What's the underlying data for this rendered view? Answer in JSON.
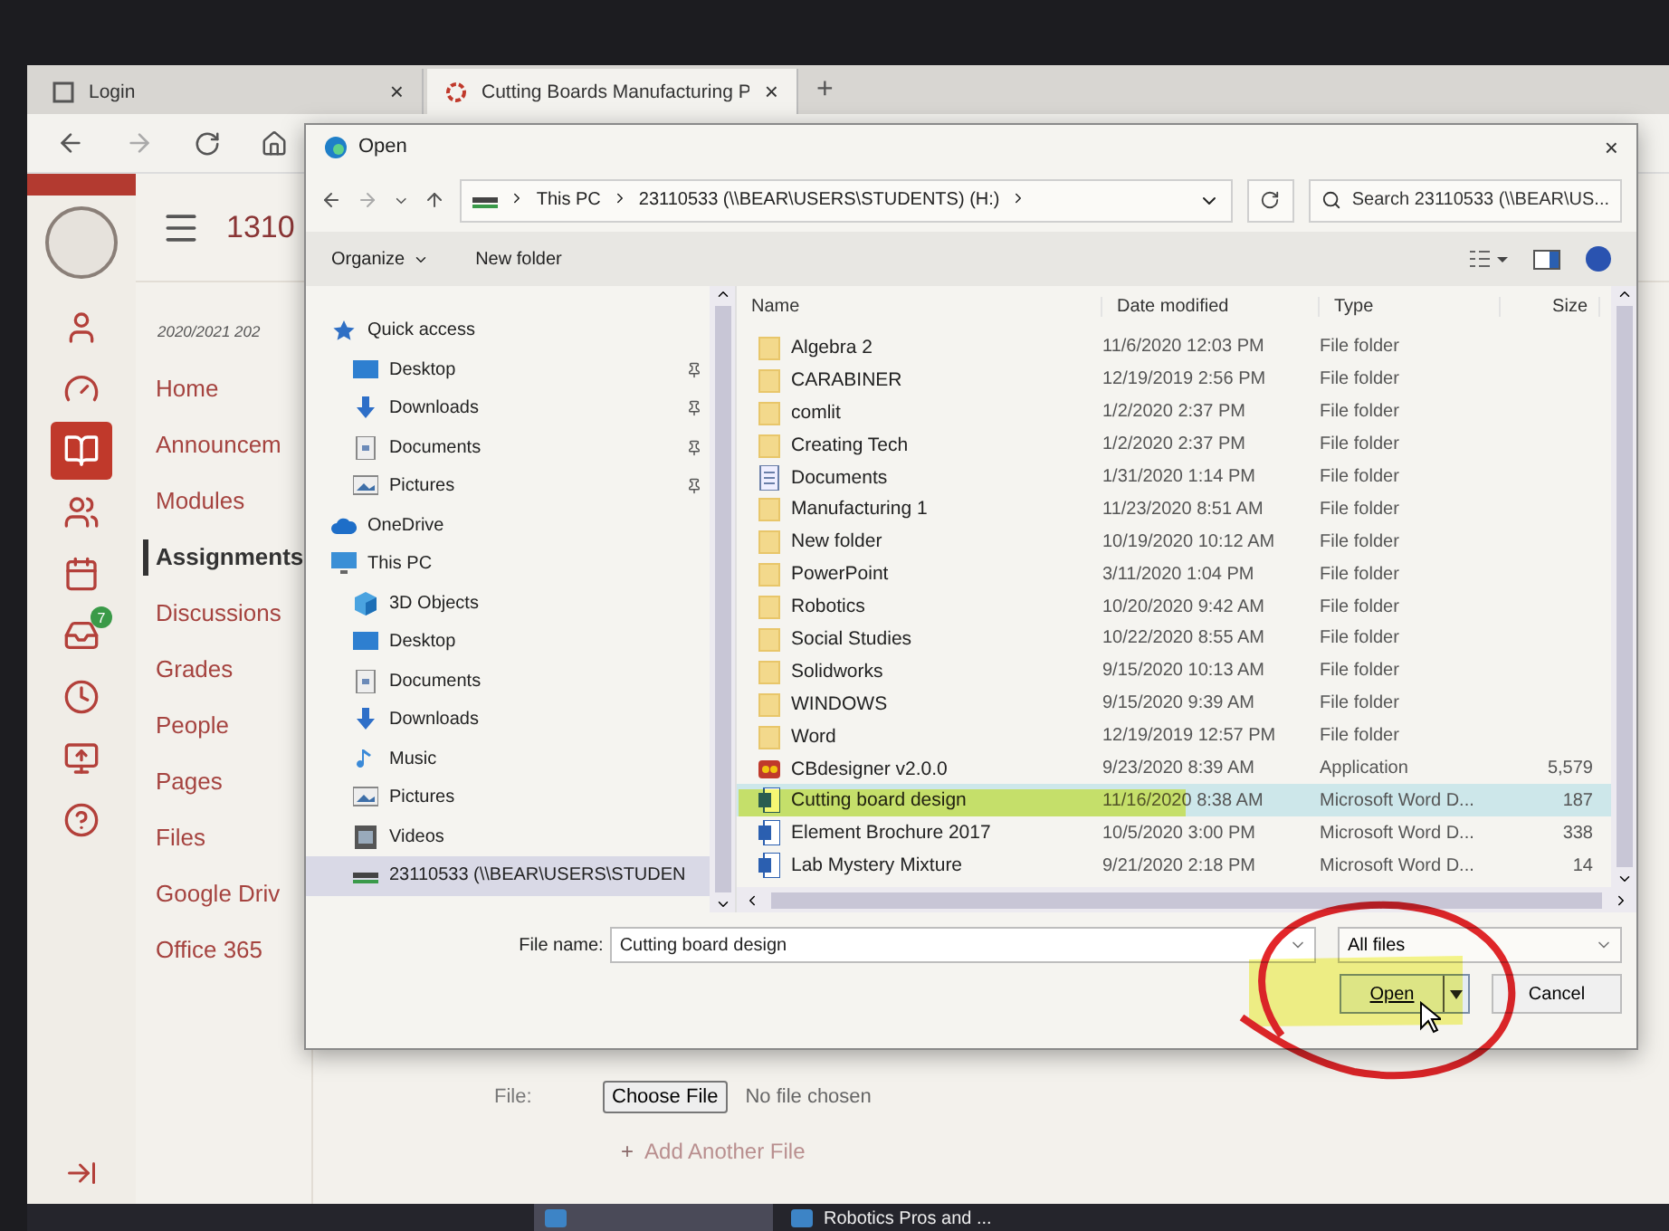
{
  "browser": {
    "tabs": [
      {
        "label": "Login",
        "close": "×",
        "selected": false
      },
      {
        "label": "Cutting Boards Manufacturing P",
        "close": "×",
        "selected": true
      }
    ],
    "new_tab": "+"
  },
  "global_nav": [
    {
      "kind": "account",
      "selected": false
    },
    {
      "kind": "dashboard",
      "selected": false
    },
    {
      "kind": "courses",
      "selected": true
    },
    {
      "kind": "groups",
      "selected": false
    },
    {
      "kind": "calendar",
      "selected": false
    },
    {
      "kind": "inbox",
      "selected": false,
      "badge": "7"
    },
    {
      "kind": "history",
      "selected": false
    },
    {
      "kind": "commons",
      "selected": false
    },
    {
      "kind": "help",
      "selected": false
    }
  ],
  "course": {
    "title": "1310",
    "term": "2020/2021 202",
    "nav": [
      {
        "label": "Home",
        "selected": false
      },
      {
        "label": "Announcem",
        "selected": false
      },
      {
        "label": "Modules",
        "selected": false
      },
      {
        "label": "Assignments",
        "selected": true
      },
      {
        "label": "Discussions",
        "selected": false
      },
      {
        "label": "Grades",
        "selected": false
      },
      {
        "label": "People",
        "selected": false
      },
      {
        "label": "Pages",
        "selected": false
      },
      {
        "label": "Files",
        "selected": false
      },
      {
        "label": "Google Driv",
        "selected": false
      },
      {
        "label": "Office 365",
        "selected": false
      }
    ]
  },
  "upload": {
    "label": "File:",
    "button": "Choose File",
    "status": "No file chosen",
    "add_icon": "+",
    "add": "Add Another File"
  },
  "taskbar": [
    {
      "selected": true
    },
    {
      "label": "Robotics Pros and ...",
      "selected": false
    }
  ],
  "dialog": {
    "title": "Open",
    "close": "×",
    "path": [
      "This PC",
      "23110533 (\\\\BEAR\\USERS\\STUDENTS) (H:)"
    ],
    "search_placeholder": "Search 23110533 (\\\\BEAR\\US...",
    "organize": "Organize",
    "new_folder": "New folder",
    "nav_pane": [
      {
        "label": "Quick access",
        "kind": "star",
        "selected": false,
        "children": [
          {
            "label": "Desktop",
            "kind": "desktop",
            "pinned": true,
            "selected": false
          },
          {
            "label": "Downloads",
            "kind": "download",
            "pinned": true,
            "selected": false
          },
          {
            "label": "Documents",
            "kind": "document",
            "pinned": true,
            "selected": false
          },
          {
            "label": "Pictures",
            "kind": "pictures",
            "pinned": true,
            "selected": false
          }
        ]
      },
      {
        "label": "OneDrive",
        "kind": "cloud",
        "selected": false
      },
      {
        "label": "This PC",
        "kind": "pc",
        "selected": false,
        "children": [
          {
            "label": "3D Objects",
            "kind": "cube",
            "selected": false
          },
          {
            "label": "Desktop",
            "kind": "desktop",
            "selected": false
          },
          {
            "label": "Documents",
            "kind": "document",
            "selected": false
          },
          {
            "label": "Downloads",
            "kind": "download",
            "selected": false
          },
          {
            "label": "Music",
            "kind": "music",
            "selected": false
          },
          {
            "label": "Pictures",
            "kind": "pictures",
            "selected": false
          },
          {
            "label": "Videos",
            "kind": "video",
            "selected": false
          },
          {
            "label": "23110533 (\\\\BEAR\\USERS\\STUDEN",
            "kind": "drive",
            "selected": true
          }
        ]
      }
    ],
    "columns": [
      "Name",
      "Date modified",
      "Type",
      "Size"
    ],
    "files": [
      {
        "name": "Algebra 2",
        "kind": "folder",
        "date": "11/6/2020 12:03 PM",
        "type": "File folder",
        "selected": false
      },
      {
        "name": "CARABINER",
        "kind": "folder",
        "date": "12/19/2019 2:56 PM",
        "type": "File folder",
        "selected": false
      },
      {
        "name": "comlit",
        "kind": "folder",
        "date": "1/2/2020 2:37 PM",
        "type": "File folder",
        "selected": false
      },
      {
        "name": "Creating Tech",
        "kind": "folder",
        "date": "1/2/2020 2:37 PM",
        "type": "File folder",
        "selected": false
      },
      {
        "name": "Documents",
        "kind": "docfolder",
        "date": "1/31/2020 1:14 PM",
        "type": "File folder",
        "selected": false
      },
      {
        "name": "Manufacturing 1",
        "kind": "folder",
        "date": "11/23/2020 8:51 AM",
        "type": "File folder",
        "selected": false
      },
      {
        "name": "New folder",
        "kind": "folder",
        "date": "10/19/2020 10:12 AM",
        "type": "File folder",
        "selected": false
      },
      {
        "name": "PowerPoint",
        "kind": "folder",
        "date": "3/11/2020 1:04 PM",
        "type": "File folder",
        "selected": false
      },
      {
        "name": "Robotics",
        "kind": "folder",
        "date": "10/20/2020 9:42 AM",
        "type": "File folder",
        "selected": false
      },
      {
        "name": "Social Studies",
        "kind": "folder",
        "date": "10/22/2020 8:55 AM",
        "type": "File folder",
        "selected": false
      },
      {
        "name": "Solidworks",
        "kind": "folder",
        "date": "9/15/2020 10:13 AM",
        "type": "File folder",
        "selected": false
      },
      {
        "name": "WINDOWS",
        "kind": "folder",
        "date": "9/15/2020 9:39 AM",
        "type": "File folder",
        "selected": false
      },
      {
        "name": "Word",
        "kind": "folder",
        "date": "12/19/2019 12:57 PM",
        "type": "File folder",
        "selected": false
      },
      {
        "name": "CBdesigner v2.0.0",
        "kind": "app",
        "date": "9/23/2020 8:39 AM",
        "type": "Application",
        "size": "5,579",
        "selected": false
      },
      {
        "name": "Cutting board design",
        "kind": "word",
        "date": "11/16/2020 8:38 AM",
        "type": "Microsoft Word D...",
        "size": "187",
        "selected": true
      },
      {
        "name": "Element Brochure 2017",
        "kind": "word",
        "date": "10/5/2020 3:00 PM",
        "type": "Microsoft Word D...",
        "size": "338",
        "selected": false
      },
      {
        "name": "Lab Mystery Mixture",
        "kind": "word",
        "date": "9/21/2020 2:18 PM",
        "type": "Microsoft Word D...",
        "size": "14",
        "selected": false
      }
    ],
    "file_name_label": "File name:",
    "file_name": "Cutting board design",
    "filter": "All files",
    "open": "Open",
    "cancel": "Cancel"
  }
}
